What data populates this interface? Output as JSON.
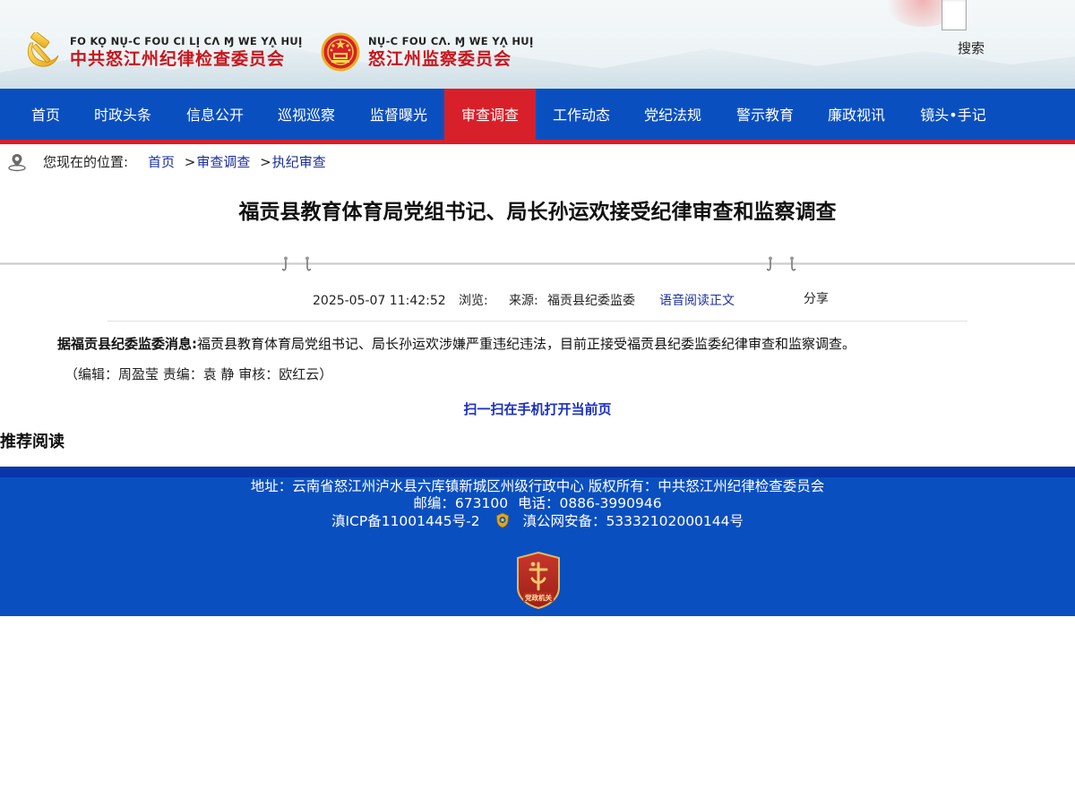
{
  "header": {
    "org1_latin": "FO KO̥ NU̥-C FOU CI LI̥ CɅ Ɱ WE YɅ̥ HUI̥",
    "org1_cn": "中共怒江州纪律检查委员会",
    "org2_latin": "NU̥-C FOU CɅ. Ɱ WE YɅ̥ HUI̥",
    "org2_cn": "怒江州监察委员会",
    "search_label": "搜索",
    "logo1_icon": "hammer-sickle-icon",
    "logo2_icon": "national-emblem-icon"
  },
  "nav": {
    "items": [
      {
        "label": "首页"
      },
      {
        "label": "时政头条"
      },
      {
        "label": "信息公开"
      },
      {
        "label": "巡视巡察"
      },
      {
        "label": "监督曝光"
      },
      {
        "label": "审查调查",
        "active": true
      },
      {
        "label": "工作动态"
      },
      {
        "label": "党纪法规"
      },
      {
        "label": "警示教育"
      },
      {
        "label": "廉政视讯"
      },
      {
        "label": "镜头•手记"
      }
    ]
  },
  "breadcrumb": {
    "prefix": "您现在的位置:",
    "items": [
      "首页",
      "审查调查",
      "执纪审查"
    ],
    "separator": ">"
  },
  "article": {
    "title": "福贡县教育体育局党组书记、局长孙运欢接受纪律审查和监察调查",
    "datetime": "2025-05-07 11:42:52",
    "views_label": "浏览:",
    "source_label": "来源:",
    "source": "福贡县纪委监委",
    "audio_link": "语音阅读正文",
    "share_label": "分享",
    "lead_bold": "据福贡县纪委监委消息:",
    "body": "福贡县教育体育局党组书记、局长孙运欢涉嫌严重违纪违法，目前正接受福贡县纪委监委纪律审查和监察调查。",
    "editor_line": "（编辑：周盈莹  责编：袁 静  审核：欧红云）",
    "qr_text": "扫一扫在手机打开当前页"
  },
  "recommended": {
    "heading": "推荐阅读"
  },
  "footer": {
    "address": "地址：云南省怒江州泸水县六库镇新城区州级行政中心 版权所有：中共怒江州纪律检查委员会",
    "postcode": "邮编：673100",
    "phone": "电话：0886-3990946",
    "icp": "滇ICP备11001445号-2",
    "police_record": "滇公网安备：53332102000144号",
    "badge_text": "党政机关"
  },
  "colors": {
    "nav_blue": "#0a4fc0",
    "active_red": "#d8202a",
    "org_red": "#c8161d",
    "link_blue": "#1a2f9e"
  }
}
